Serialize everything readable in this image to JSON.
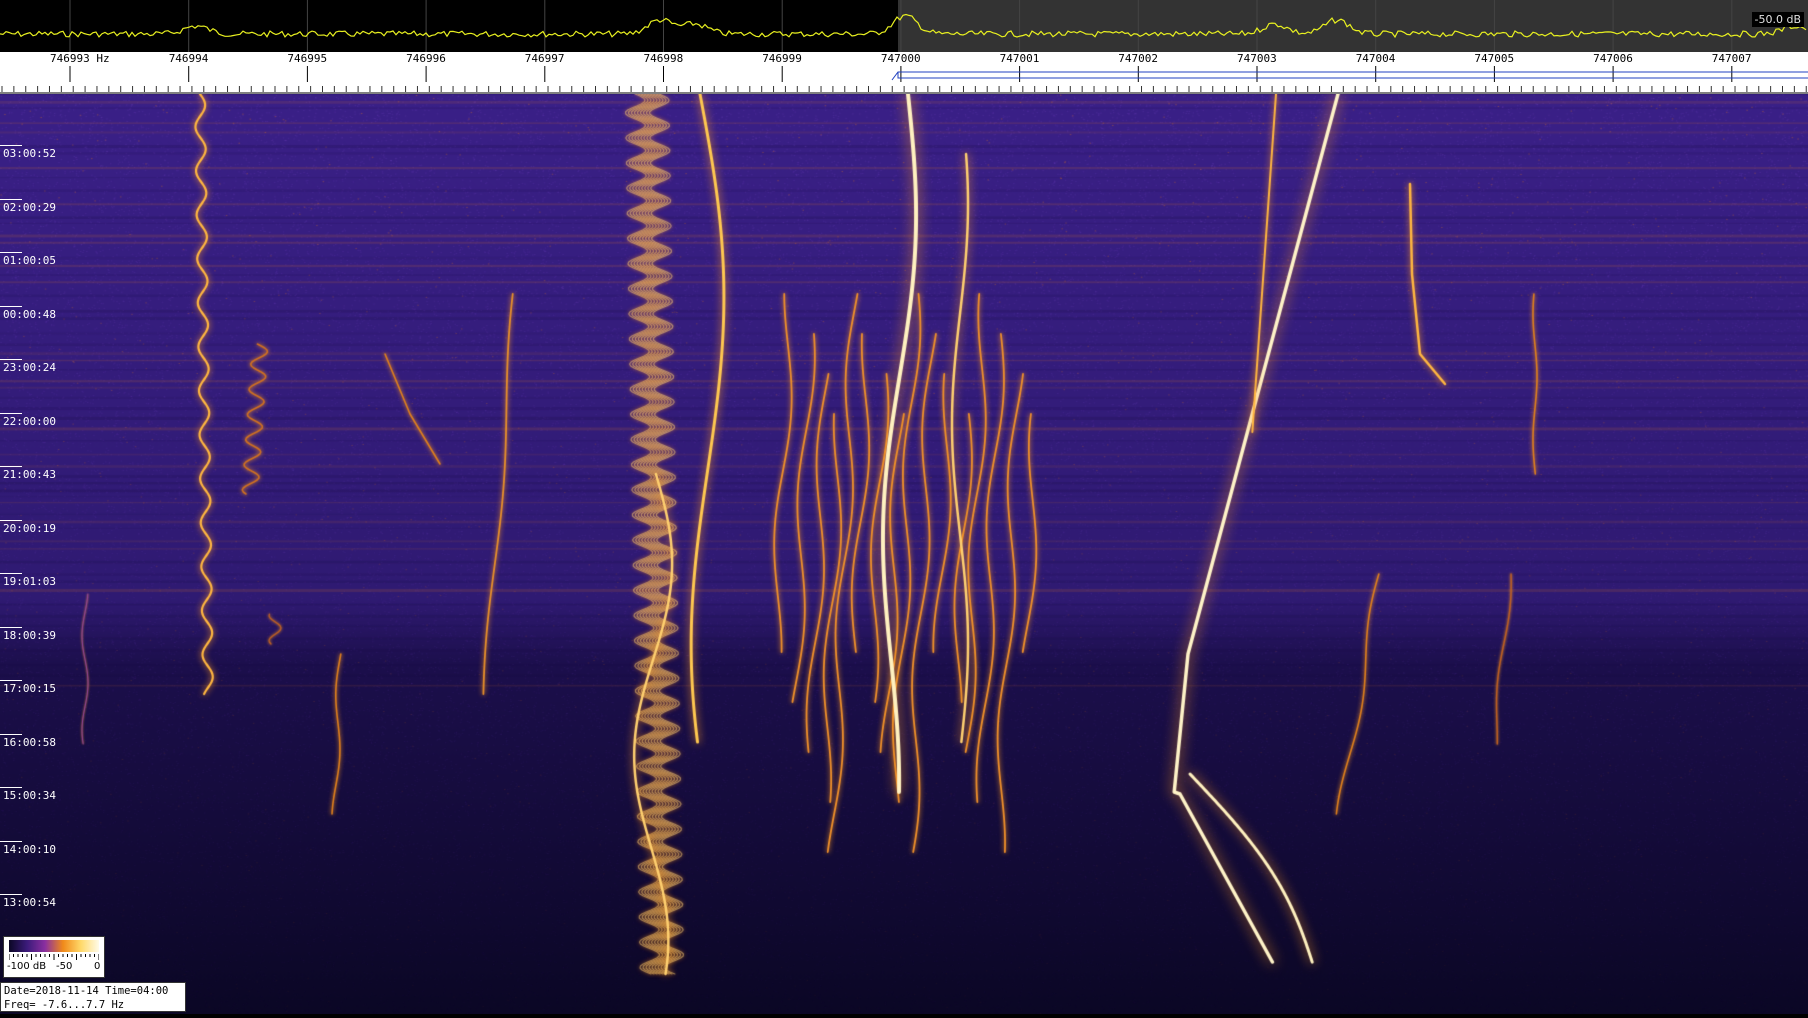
{
  "spectrum": {
    "level_label": "-50.0 dB"
  },
  "frequency_axis": {
    "labels": [
      "746993 Hz",
      "746994",
      "746995",
      "746996",
      "746997",
      "746998",
      "746999",
      "747000",
      "747001",
      "747002",
      "747003",
      "747004",
      "747005",
      "747006",
      "747007"
    ]
  },
  "time_axis": {
    "labels": [
      "03:00:52",
      "02:00:29",
      "01:00:05",
      "00:00:48",
      "23:00:24",
      "22:00:00",
      "21:00:43",
      "20:00:19",
      "19:01:03",
      "18:00:39",
      "17:00:15",
      "16:00:58",
      "15:00:34",
      "14:00:10",
      "13:00:54"
    ]
  },
  "legend": {
    "min_label": "-100 dB",
    "mid_label": "-50",
    "max_label": "0"
  },
  "info": {
    "line1": "Date=2018-11-14 Time=04:00",
    "line2": "Freq= -7.6...7.7 Hz"
  },
  "colors": {
    "background": "#0b0725",
    "noise": "#2b1766",
    "signal_low": "#e27a1b",
    "signal_high": "#ffe9a6",
    "spectrum_trace": "#e8f020"
  }
}
